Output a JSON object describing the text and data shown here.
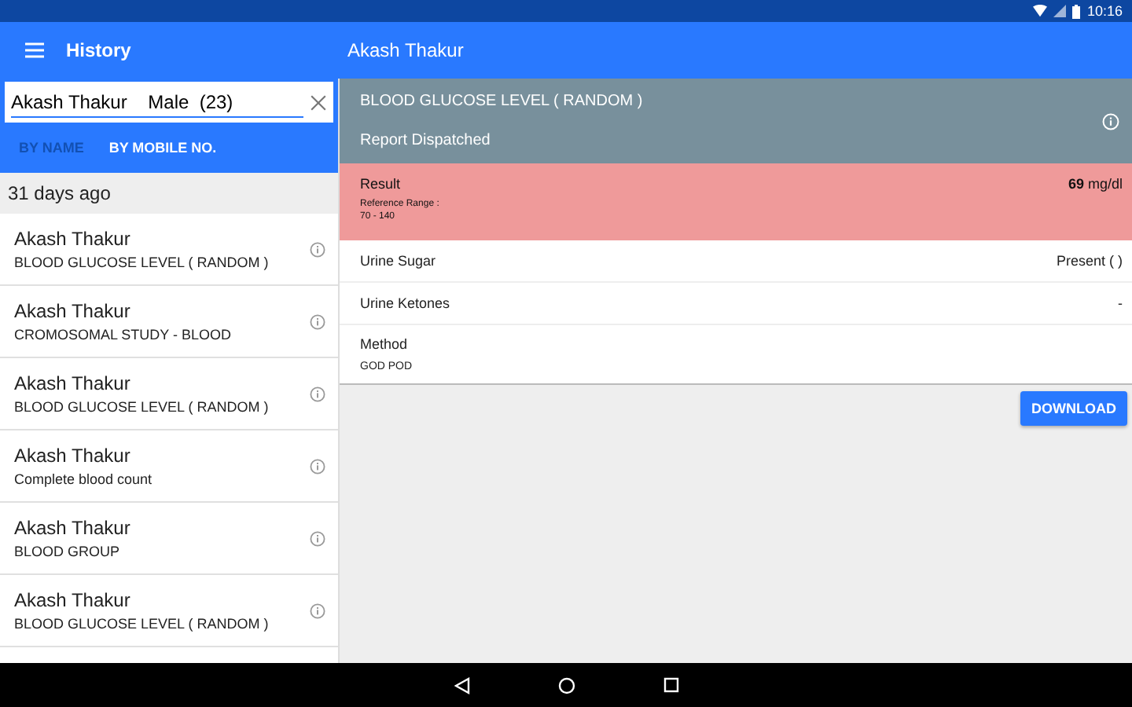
{
  "status_bar": {
    "time": "10:16"
  },
  "app_bar": {
    "title": "History",
    "detail_title": "Akash Thakur"
  },
  "search": {
    "value": "Akash Thakur    Male  (23)"
  },
  "tabs": [
    {
      "label": "BY NAME",
      "selected": false
    },
    {
      "label": "BY MOBILE NO.",
      "selected": true
    }
  ],
  "section_header": "31 days ago",
  "history": [
    {
      "name": "Akash Thakur",
      "test": "BLOOD GLUCOSE LEVEL ( RANDOM )"
    },
    {
      "name": "Akash Thakur",
      "test": "CROMOSOMAL STUDY - BLOOD"
    },
    {
      "name": "Akash Thakur",
      "test": "BLOOD GLUCOSE LEVEL ( RANDOM )"
    },
    {
      "name": "Akash Thakur",
      "test": "Complete blood count"
    },
    {
      "name": "Akash Thakur",
      "test": "BLOOD GROUP"
    },
    {
      "name": "Akash Thakur",
      "test": "BLOOD GLUCOSE LEVEL ( RANDOM )"
    }
  ],
  "report": {
    "title": "BLOOD GLUCOSE LEVEL ( RANDOM )",
    "status": "Report Dispatched",
    "result": {
      "label": "Result",
      "value": "69",
      "unit": "mg/dl",
      "range_label": "Reference Range :",
      "range": "70 - 140",
      "abnormal": true
    },
    "rows": [
      {
        "kind": "pair",
        "label": "Urine Sugar",
        "value": "Present ( )"
      },
      {
        "kind": "pair",
        "label": "Urine Ketones",
        "value": "-"
      },
      {
        "kind": "method",
        "label": "Method",
        "value": "GOD POD"
      }
    ],
    "button": "DOWNLOAD"
  }
}
